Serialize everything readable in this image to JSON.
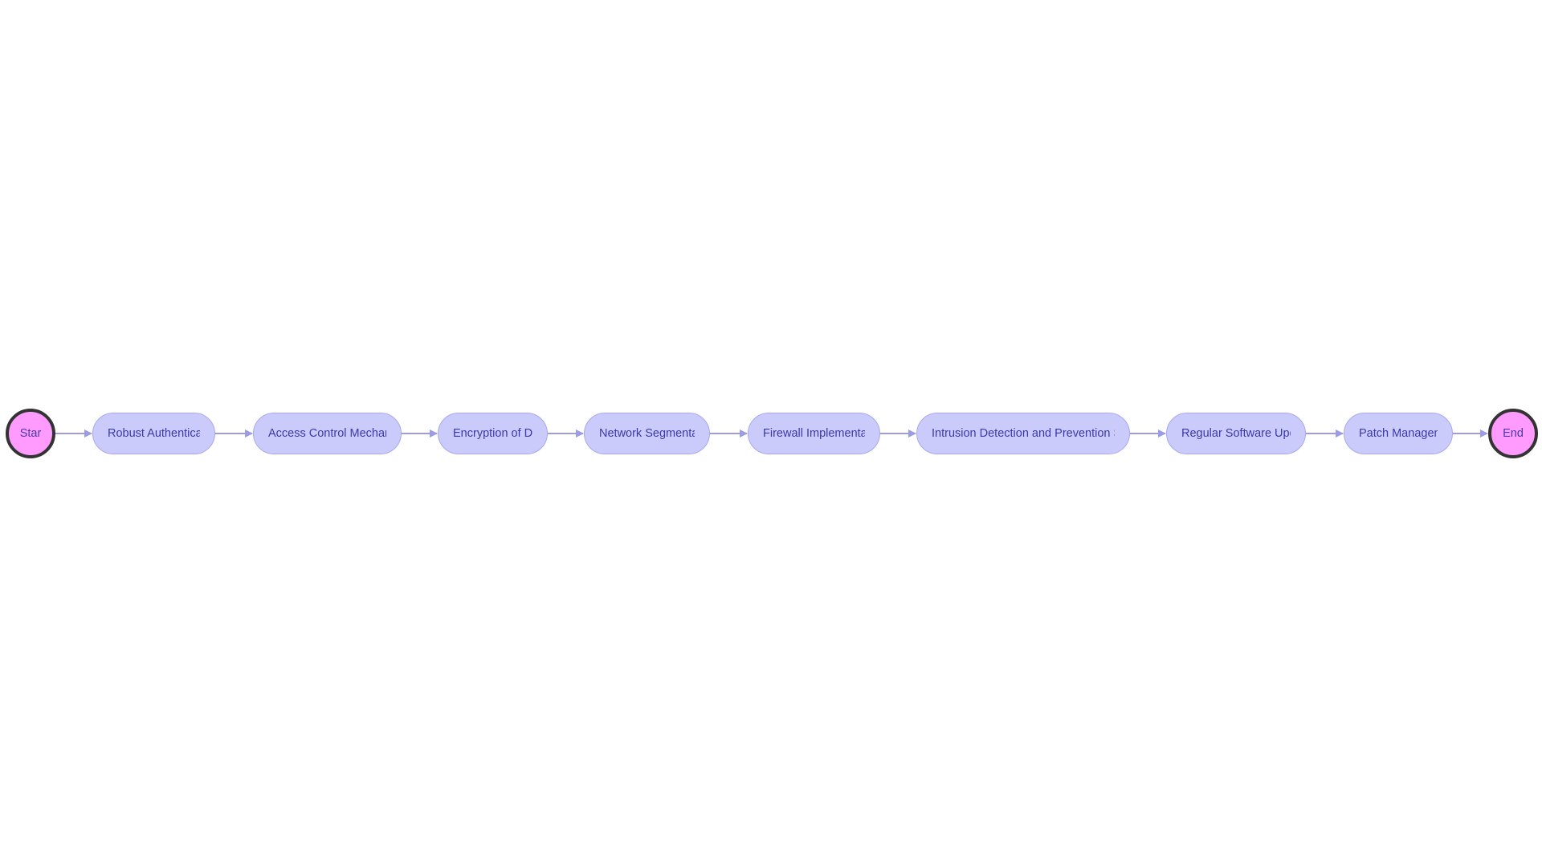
{
  "diagram": {
    "type": "flowchart",
    "direction": "left-to-right",
    "colors": {
      "node_fill": "#cbcbfb",
      "node_border": "#a8a8ee",
      "terminal_fill": "#ff9bff",
      "terminal_border": "#333333",
      "edge": "#9b9be6",
      "text": "#3a3aa8"
    },
    "start": {
      "label": "Star"
    },
    "end": {
      "label": "End"
    },
    "steps": [
      {
        "label": "Robust Authenticat"
      },
      {
        "label": "Access Control Mechanis"
      },
      {
        "label": "Encryption of Dat"
      },
      {
        "label": "Network Segmentat"
      },
      {
        "label": "Firewall Implementatic"
      },
      {
        "label": "Intrusion Detection and Prevention Sys"
      },
      {
        "label": "Regular Software Upda"
      },
      {
        "label": "Patch Manageme"
      }
    ]
  }
}
